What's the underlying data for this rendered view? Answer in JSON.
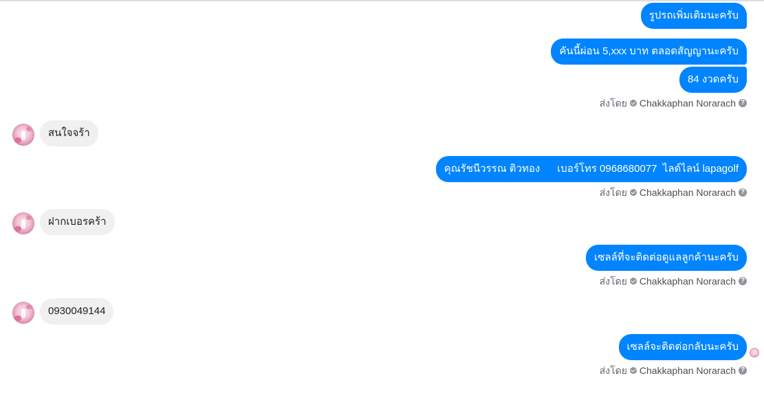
{
  "conversation": {
    "sender_name": "Chakkaphan Norarach",
    "sent_by_label": "ส่งโดย",
    "help_glyph": "?",
    "messages": [
      {
        "direction": "out",
        "text": "รูปรถเพิ่มเติมนะครับ"
      },
      {
        "direction": "out",
        "text": "คันนี้ผ่อน 5,xxx บาท ตลอดสัญญานะครับ"
      },
      {
        "direction": "out",
        "text": "84 งวดครับ"
      },
      {
        "direction": "in",
        "text": "สนใจจร้า"
      },
      {
        "direction": "out",
        "text": "คุณรัชนีวรรณ ติวทอง      เบอร์โทร 0968680077  ไลด์ไลน์ lapagolf"
      },
      {
        "direction": "in",
        "text": "ฝากเบอรคร้า"
      },
      {
        "direction": "out",
        "text": "เซลล์ที่จะติดต่อดูแลลูกค้านะครับ"
      },
      {
        "direction": "in",
        "text": "0930049144"
      },
      {
        "direction": "out",
        "text": "เซลล์จะติดต่อกลับนะครับ"
      }
    ]
  },
  "colors": {
    "outgoing_bubble": "#0084ff",
    "incoming_bubble": "#f1f0f0",
    "meta_text": "#4b4f56"
  },
  "icons": {
    "page_badge": "check-badge-icon",
    "help": "question-circle-icon",
    "avatar": "contact-avatar",
    "seen": "seen-avatar-icon"
  }
}
